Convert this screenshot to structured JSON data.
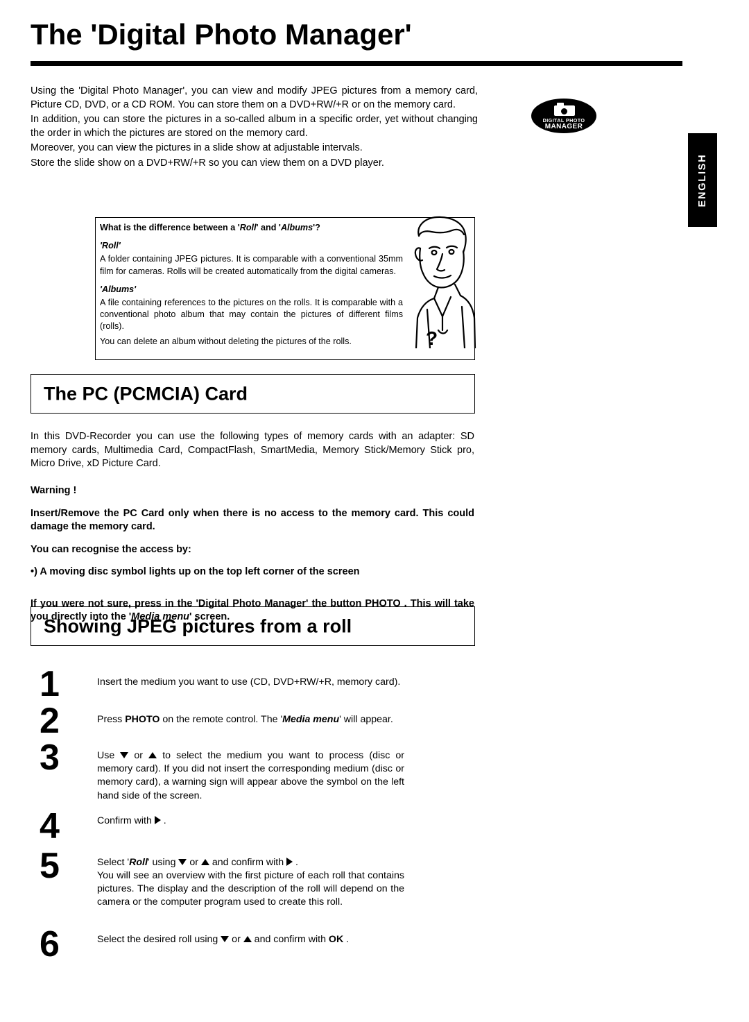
{
  "document": {
    "title": "The 'Digital Photo Manager'",
    "language_tab": "ENGLISH"
  },
  "logo": {
    "line1": "DIGITAL PHOTO",
    "line2": "MANAGER",
    "icon": "digital-camera-icon"
  },
  "intro": {
    "p1": "Using the 'Digital Photo Manager', you can view and modify JPEG pictures from a memory card, Picture CD, DVD, or a CD ROM. You can store them on a DVD+RW/+R or on the memory card.",
    "p2": "In addition, you can store the pictures in a so-called album in a specific order, yet without changing the order in which the pictures are stored on the memory card.",
    "p3": "Moreover, you can view the pictures in a slide show at adjustable intervals.",
    "p4": "Store the slide show on a DVD+RW/+R so you can view them on a DVD player."
  },
  "info_box": {
    "question_pre": "What is the difference between a '",
    "question_roll": "Roll",
    "question_mid": "' and '",
    "question_albums": "Albums",
    "question_post": "'?",
    "roll_heading": "'Roll'",
    "roll_text": "A folder containing JPEG pictures. It is comparable with a conventional 35mm film for cameras. Rolls will be created automatically from the digital cameras.",
    "albums_heading": "'Albums'",
    "albums_text": "A file containing references to the pictures on the rolls. It is comparable with a conventional photo album that may contain the pictures of different films (rolls).",
    "albums_text2": "You can delete an album without deleting the pictures of the rolls.",
    "question_mark": "?"
  },
  "sections": {
    "pc_card": {
      "title": "The PC (PCMCIA) Card",
      "paragraph": "In this DVD-Recorder you can use the following types of memory cards with an adapter: SD memory cards, Multimedia Card, CompactFlash, SmartMedia, Memory Stick/Memory Stick pro, Micro Drive, xD Picture Card.",
      "warning_heading": "Warning !",
      "warning_text": "Insert/Remove the PC Card only when there is no access to the memory card. This could damage the memory card.",
      "recognise_heading": "You can recognise the access by:",
      "bullet": "•) A moving disc symbol lights up on the top left corner of the screen",
      "note_pre": "If you were not sure, press in the 'Digital Photo Manager' the button  PHOTO . This will take you directly into the '",
      "note_italic": "Media menu",
      "note_post": "' screen."
    },
    "showing_jpeg": {
      "title": "Showing JPEG pictures from a roll",
      "steps": [
        {
          "number": "1",
          "text": "Insert the medium you want to use (CD, DVD+RW/+R, memory card)."
        },
        {
          "number": "2",
          "text_pre": "Press  ",
          "text_bold": "PHOTO",
          "text_mid": " on the remote control. The '",
          "text_italic": "Media menu",
          "text_post": "' will appear."
        },
        {
          "number": "3",
          "text_pre": "Use  ",
          "text_post": "  to select the medium you want to process (disc or memory card). If you did not insert the corresponding medium (disc or memory card), a warning sign will appear above the symbol on the left hand side of the screen.",
          "text_mid": "  or  "
        },
        {
          "number": "4",
          "text": "Confirm with"
        },
        {
          "number": "5",
          "text_pre": "Select '",
          "text_italic": "Roll",
          "text_mid": "' using  ",
          "text_mid2": "  or  ",
          "text_post": "  and confirm with",
          "text_body": "You will see an overview with the first picture of each roll that contains pictures. The display and the description of the roll will depend on the camera or the computer program used to create this roll."
        },
        {
          "number": "6",
          "text_pre": "Select the desired roll using  ",
          "text_mid": "  or  ",
          "text_post": "  and confirm with  ",
          "text_bold": "OK",
          "text_end": " ."
        }
      ]
    }
  }
}
